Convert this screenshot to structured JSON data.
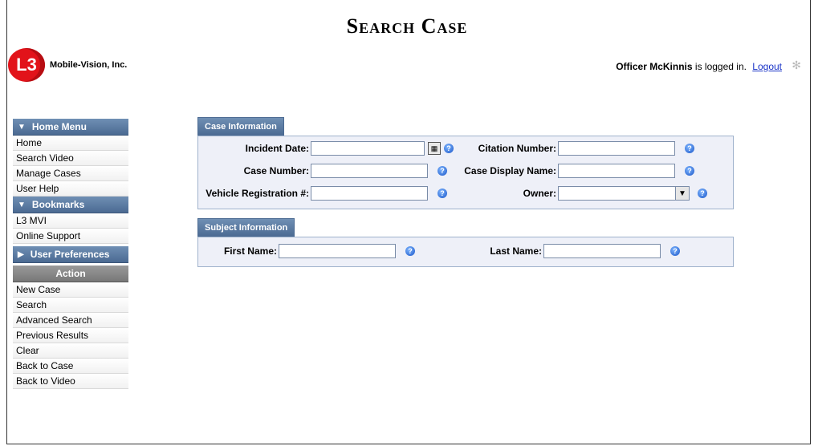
{
  "page": {
    "title": "Search Case"
  },
  "branding": {
    "logo_badge": "L3",
    "company": "Mobile-Vision, Inc."
  },
  "user": {
    "name": "Officer McKinnis",
    "status_suffix": "is logged in.",
    "logout_label": "Logout"
  },
  "sidebar": {
    "home_menu": {
      "label": "Home Menu",
      "items": [
        "Home",
        "Search Video",
        "Manage Cases",
        "User Help"
      ]
    },
    "bookmarks": {
      "label": "Bookmarks",
      "items": [
        "L3 MVI",
        "Online Support"
      ]
    },
    "user_preferences": {
      "label": "User Preferences"
    },
    "action": {
      "label": "Action",
      "items": [
        "New Case",
        "Search",
        "Advanced Search",
        "Previous Results",
        "Clear",
        "Back to Case",
        "Back to Video"
      ]
    }
  },
  "case_info": {
    "tab_label": "Case Information",
    "incident_date": {
      "label": "Incident Date:",
      "value": ""
    },
    "citation_number": {
      "label": "Citation Number:",
      "value": ""
    },
    "case_number": {
      "label": "Case Number:",
      "value": ""
    },
    "case_display_name": {
      "label": "Case Display Name:",
      "value": ""
    },
    "vehicle_registration": {
      "label": "Vehicle Registration #:",
      "value": ""
    },
    "owner": {
      "label": "Owner:",
      "selected": ""
    }
  },
  "subject_info": {
    "tab_label": "Subject Information",
    "first_name": {
      "label": "First Name:",
      "value": ""
    },
    "last_name": {
      "label": "Last Name:",
      "value": ""
    }
  },
  "icons": {
    "help": "?",
    "calendar": "▦",
    "dropdown": "▼",
    "collapsed": "▶",
    "expanded": "▼"
  },
  "colors": {
    "menu_blue": "#5a7aa3",
    "action_grey": "#888888",
    "link_blue": "#1a34c8",
    "logo_red": "#e2131a"
  }
}
